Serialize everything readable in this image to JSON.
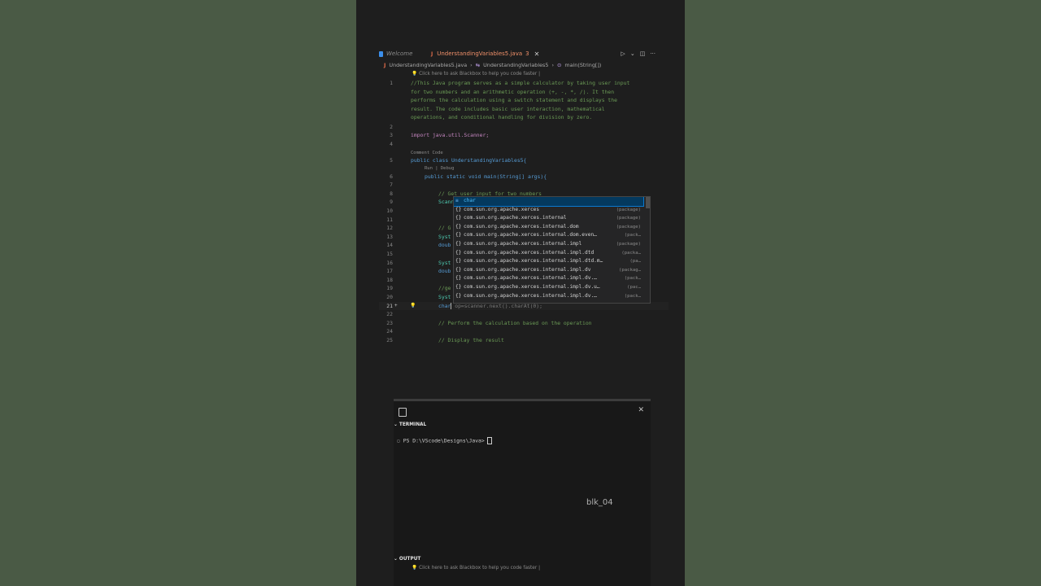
{
  "tabs": {
    "welcome": "Welcome",
    "active": "UnderstandingVariables5.java",
    "active_badge": "3"
  },
  "breadcrumb": [
    "UnderstandingVariables5.java",
    "UnderstandingVariables5",
    "main(String[])"
  ],
  "hint": "Click here to ask Blackbox to help you code faster |",
  "codelens": {
    "comment_code": "Comment Code",
    "run_debug": "Run | Debug"
  },
  "lines": [
    {
      "n": "1",
      "t": "//This Java program serves as a simple calculator by taking user input"
    },
    {
      "n": "",
      "t": "for two numbers and an arithmetic operation (+, -, *, /). It then"
    },
    {
      "n": "",
      "t": "performs the calculation using a switch statement and displays the"
    },
    {
      "n": "",
      "t": "result. The code includes basic user interaction, mathematical"
    },
    {
      "n": "",
      "t": "operations, and conditional handling for division by zero."
    },
    {
      "n": "2",
      "t": ""
    },
    {
      "n": "3",
      "t": "import java.util.Scanner;"
    },
    {
      "n": "4",
      "t": ""
    },
    {
      "n": "5",
      "t": "public class UnderstandingVariables5{"
    },
    {
      "n": "6",
      "t": "public static void main(String[] args){"
    },
    {
      "n": "7",
      "t": ""
    },
    {
      "n": "8",
      "t": "// Get user input for two numbers"
    },
    {
      "n": "9",
      "t": "Scann"
    },
    {
      "n": "10",
      "t": ""
    },
    {
      "n": "11",
      "t": ""
    },
    {
      "n": "12",
      "t": "// G"
    },
    {
      "n": "13",
      "t": "Syst"
    },
    {
      "n": "14",
      "t": "doub"
    },
    {
      "n": "15",
      "t": ""
    },
    {
      "n": "16",
      "t": "Syst"
    },
    {
      "n": "17",
      "t": "doub"
    },
    {
      "n": "18",
      "t": ""
    },
    {
      "n": "19",
      "t": "//ge"
    },
    {
      "n": "20",
      "t": "Syst"
    },
    {
      "n": "21",
      "t": "char",
      "ghost": " op=scanner.next().charAt(0);"
    },
    {
      "n": "22",
      "t": ""
    },
    {
      "n": "23",
      "t": "// Perform the calculation based on the operation"
    },
    {
      "n": "24",
      "t": ""
    },
    {
      "n": "25",
      "t": "// Display the result"
    }
  ],
  "suggest": {
    "selected": "char",
    "items": [
      {
        "label": "com.sun.org.apache.xerces",
        "detail": "(package)"
      },
      {
        "label": "com.sun.org.apache.xerces.internal",
        "detail": "(package)"
      },
      {
        "label": "com.sun.org.apache.xerces.internal.dom",
        "detail": "(package)"
      },
      {
        "label": "com.sun.org.apache.xerces.internal.dom.even…",
        "detail": "(pack…"
      },
      {
        "label": "com.sun.org.apache.xerces.internal.impl",
        "detail": "(package)"
      },
      {
        "label": "com.sun.org.apache.xerces.internal.impl.dtd",
        "detail": "(packa…"
      },
      {
        "label": "com.sun.org.apache.xerces.internal.impl.dtd.m…",
        "detail": "(pa…"
      },
      {
        "label": "com.sun.org.apache.xerces.internal.impl.dv",
        "detail": "(packag…"
      },
      {
        "label": "com.sun.org.apache.xerces.internal.impl.dv.…",
        "detail": "(pack…"
      },
      {
        "label": "com.sun.org.apache.xerces.internal.impl.dv.u…",
        "detail": "(pac…"
      },
      {
        "label": "com.sun.org.apache.xerces.internal.impl.dv.…",
        "detail": "(pack…"
      }
    ]
  },
  "panel": {
    "terminal_title": "TERMINAL",
    "prompt": "PS D:\\VScode\\Designs\\Java>",
    "watermark": "blk_04",
    "output_title": "OUTPUT",
    "output_hint": "Click here to ask Blackbox to help you code faster |"
  }
}
